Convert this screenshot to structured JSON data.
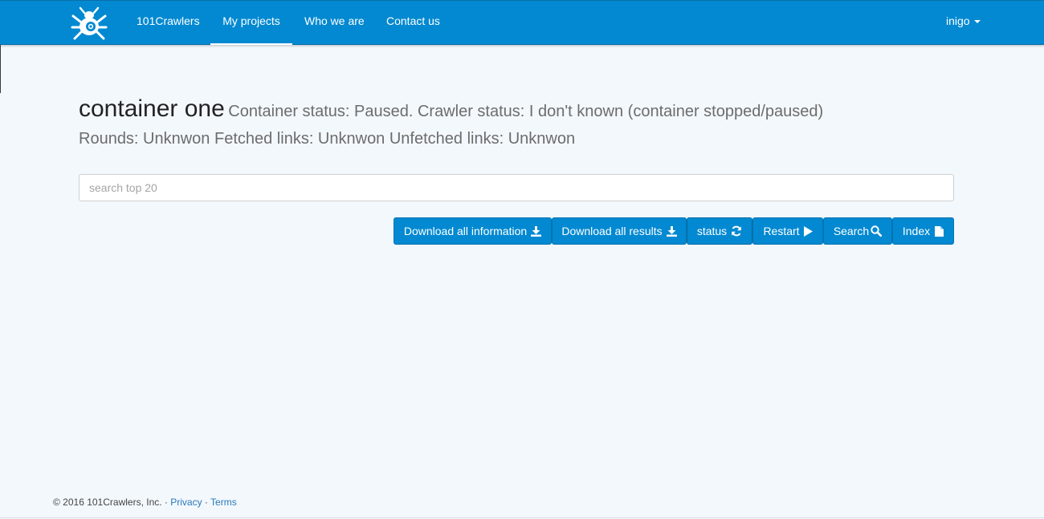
{
  "navbar": {
    "brand": "101Crawlers",
    "links": [
      {
        "label": "My projects",
        "active": true
      },
      {
        "label": "Who we are",
        "active": false
      },
      {
        "label": "Contact us",
        "active": false
      }
    ],
    "user": "inigo",
    "logo_icon": "spider-logo-icon",
    "color": "#0289d1"
  },
  "project": {
    "name": "container one",
    "status_line": "Container status: Paused. Crawler status: I don't known (container stopped/paused)",
    "stats_line": "Rounds: Unknwon Fetched links: Unknwon Unfetched links: Unknwon"
  },
  "search": {
    "placeholder": "search top 20",
    "value": ""
  },
  "actions": {
    "download_info": {
      "label": "Download all information",
      "icon": "download-icon"
    },
    "download_results": {
      "label": "Download all results",
      "icon": "download-icon"
    },
    "status": {
      "label": "status",
      "icon": "refresh-icon"
    },
    "restart": {
      "label": "Restart",
      "icon": "play-icon"
    },
    "search": {
      "label": "Search",
      "icon": "magnifier-icon"
    },
    "index": {
      "label": "Index",
      "icon": "file-icon"
    }
  },
  "footer": {
    "copyright": "© 2016 101Crawlers, Inc. · ",
    "privacy": "Privacy",
    "separator": " · ",
    "terms": "Terms"
  }
}
